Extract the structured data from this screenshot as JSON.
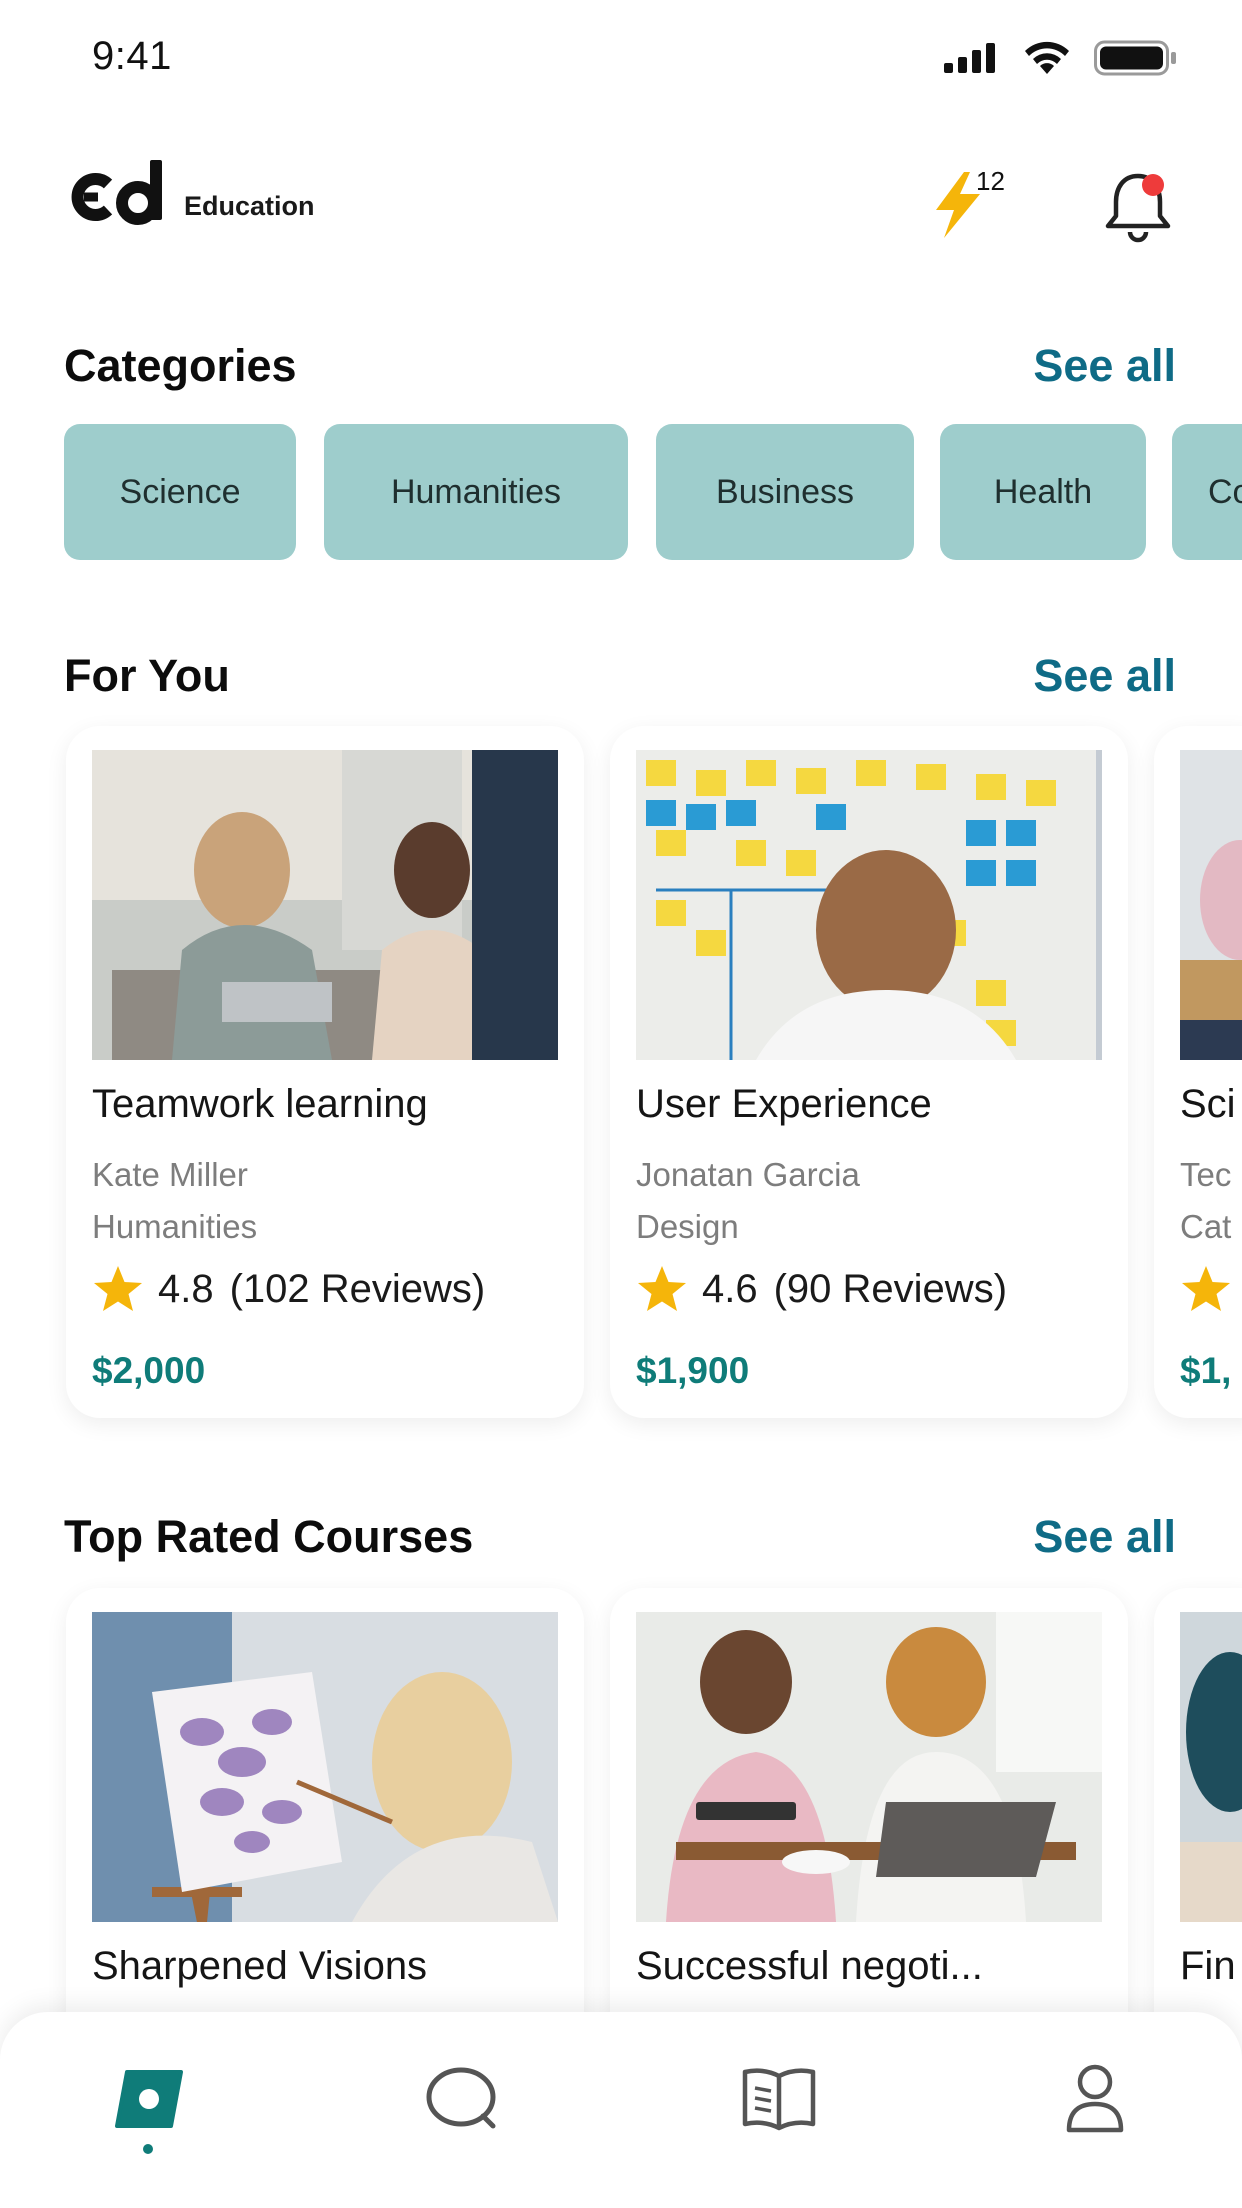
{
  "status_bar": {
    "time": "9:41"
  },
  "header": {
    "logo_text": "Education",
    "streak_count": "12"
  },
  "categories": {
    "title": "Categories",
    "see_all": "See all",
    "items": [
      {
        "label": "Science"
      },
      {
        "label": "Humanities"
      },
      {
        "label": "Business"
      },
      {
        "label": "Health"
      },
      {
        "label": "Co"
      }
    ]
  },
  "for_you": {
    "title": "For You",
    "see_all": "See all",
    "cards": [
      {
        "title": "Teamwork learning",
        "author": "Kate Miller",
        "category": "Humanities",
        "rating": "4.8",
        "reviews": "(102 Reviews)",
        "price": "$2,000"
      },
      {
        "title": "User Experience",
        "author": "Jonatan Garcia",
        "category": "Design",
        "rating": "4.6",
        "reviews": "(90 Reviews)",
        "price": "$1,900"
      },
      {
        "title": "Sci",
        "author": "Tec",
        "category": "Cat",
        "rating": "",
        "reviews": "",
        "price": "$1,"
      }
    ]
  },
  "top_rated": {
    "title": "Top Rated Courses",
    "see_all": "See all",
    "cards": [
      {
        "title": "Sharpened Visions"
      },
      {
        "title": "Successful negoti..."
      },
      {
        "title": "Fin"
      }
    ]
  },
  "colors": {
    "accent": "#0f7c79",
    "link": "#0f6b86",
    "chip_bg": "#9ecdcc",
    "star": "#f5b50a",
    "notification_dot": "#ee3b3b"
  },
  "icons": {
    "tabs": [
      "home-icon",
      "search-icon",
      "book-icon",
      "profile-icon"
    ],
    "header": [
      "lightning-icon",
      "bell-icon"
    ]
  }
}
